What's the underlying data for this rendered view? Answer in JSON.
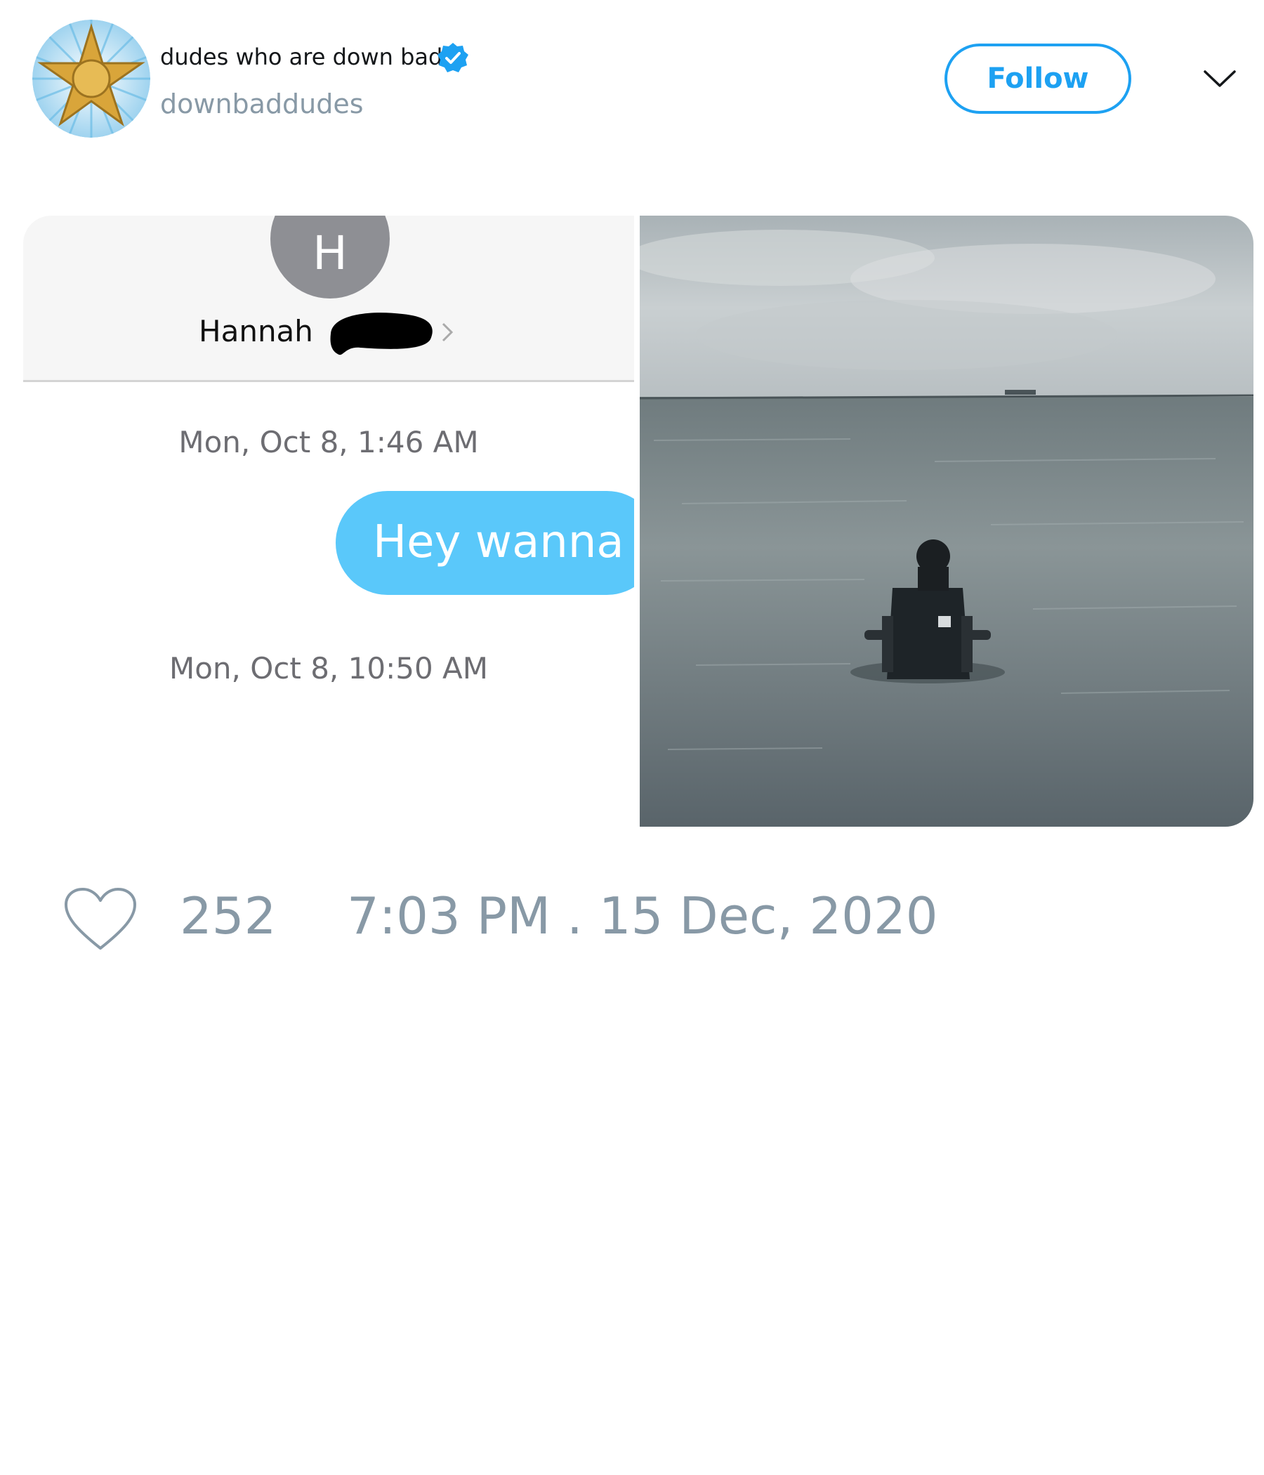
{
  "account": {
    "display_name": "dudes who are down bad",
    "handle": "downbaddudes",
    "verified_icon": "verified-badge-icon",
    "avatar_icon": "sheriff-star-icon"
  },
  "actions": {
    "follow_label": "Follow",
    "more_icon": "chevron-down-icon"
  },
  "media": {
    "left_image": {
      "contact_initial": "H",
      "contact_name": "Hannah",
      "timestamp_1": "Mon, Oct 8, 1:46 AM",
      "message": "Hey wanna",
      "timestamp_2": "Mon, Oct 8, 10:50 AM"
    },
    "right_image": {
      "description_icon": "person-in-chair-in-water-photo"
    }
  },
  "footer": {
    "like_icon": "heart-icon",
    "like_count": "252",
    "timestamp": "7:03 PM . 15 Dec, 2020"
  },
  "colors": {
    "accent": "#1da1f2",
    "muted": "#8899a6",
    "imessage_blue": "#5ac8fa"
  }
}
